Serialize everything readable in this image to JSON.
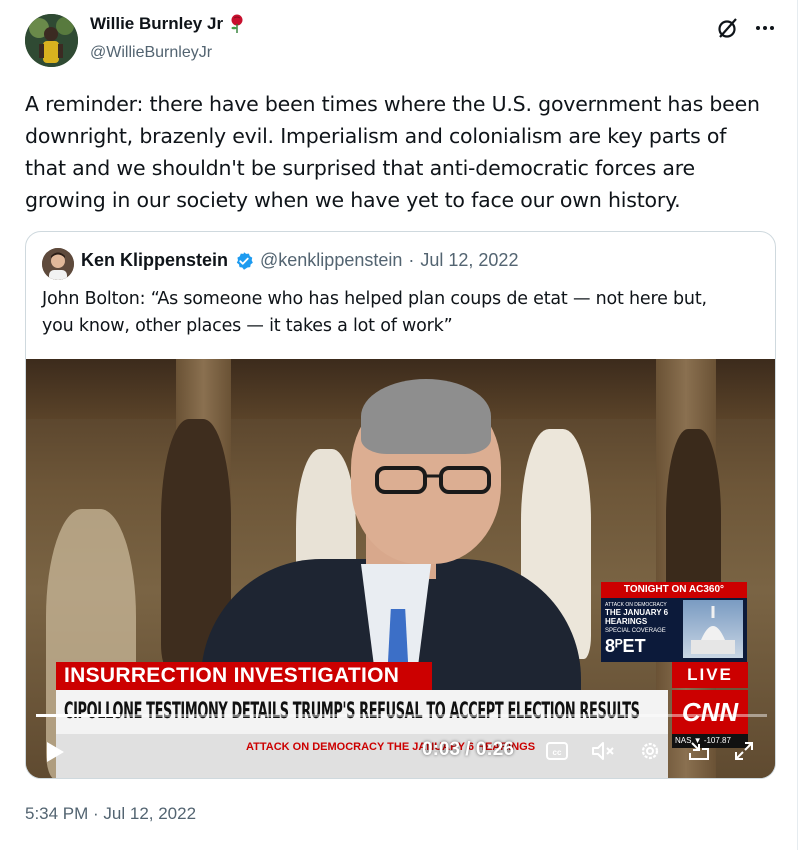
{
  "author": {
    "display_name": "Willie Burnley Jr",
    "handle": "@WillieBurnleyJr",
    "name_emoji_icon": "rose-icon"
  },
  "tweet": {
    "text": "A reminder: there have been times where the U.S. government has been\ndownright, brazenly evil. Imperialism and colonialism are key parts of\nthat and we shouldn't be surprised that anti-democratic forces are\ngrowing in our society when we have yet to face our own history.",
    "timestamp": "5:34 PM · Jul 12, 2022"
  },
  "header_icons": [
    "grok-icon",
    "more-icon"
  ],
  "quote": {
    "display_name": "Ken Klippenstein",
    "verified": true,
    "handle": "@kenklippenstein",
    "separator": "·",
    "date": "Jul 12, 2022",
    "text": "John Bolton: “As someone who has helped plan coups de etat — not here but,\nyou know, other places — it takes a lot of work”"
  },
  "video": {
    "current_time": "0:03",
    "duration": "0:26",
    "time_label": "0:03 / 0:26",
    "progress_fraction": 0.115,
    "overlay": {
      "banner_red": "INSURRECTION INVESTIGATION",
      "headline": "CIPOLLONE TESTIMONY DETAILS TRUMP'S REFUSAL TO ACCEPT ELECTION RESULTS",
      "footer": "ATTACK ON DEMOCRACY   THE JANUARY 6 HEARINGS",
      "live": "LIVE",
      "network": "CNN",
      "ticker": "NAS  ▼ -107.87",
      "promo_title": "TONIGHT ON AC360°",
      "promo_small": "ATTACK ON DEMOCRACY",
      "promo_heading": "THE JANUARY 6 HEARINGS",
      "promo_coverage": "SPECIAL COVERAGE",
      "promo_time": "8ᴾET"
    },
    "control_icons": [
      "play-icon",
      "captions-icon",
      "mute-icon",
      "settings-icon",
      "minimize-icon",
      "fullscreen-icon"
    ]
  },
  "colors": {
    "verified_blue": "#1d9bf0",
    "secondary_text": "#536471",
    "cnn_red": "#cc0000"
  }
}
